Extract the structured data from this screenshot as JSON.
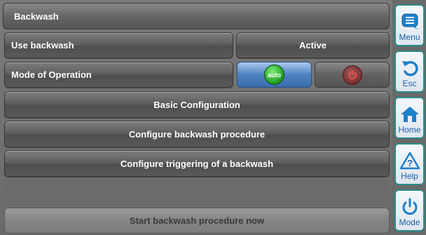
{
  "header": {
    "title": "Backwash"
  },
  "rows": {
    "use_backwash": {
      "label": "Use backwash",
      "value": "Active"
    },
    "mode": {
      "label": "Mode of Operation",
      "auto_label": "auto"
    }
  },
  "menu_buttons": {
    "basic": "Basic Configuration",
    "procedure": "Configure backwash procedure",
    "triggering": "Configure triggering of a backwash"
  },
  "start_button": "Start backwash procedure now",
  "sidebar": {
    "menu": "Menu",
    "esc": "Esc",
    "home": "Home",
    "help": "Help",
    "mode": "Mode"
  },
  "colors": {
    "accent_blue": "#4f82c2",
    "auto_green": "#1e9a1e",
    "sidebar_text": "#1a5fae",
    "sidebar_border": "#2a8a8a"
  },
  "icons": [
    "menu-icon",
    "esc-icon",
    "home-icon",
    "help-icon",
    "power-icon"
  ]
}
